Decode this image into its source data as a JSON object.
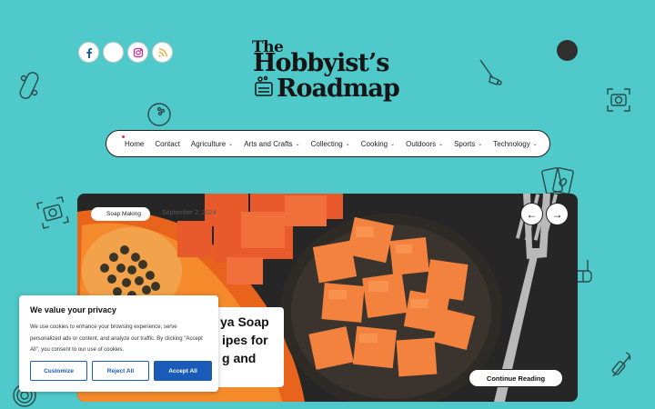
{
  "social": [
    {
      "name": "facebook",
      "icon": "facebook-icon"
    },
    {
      "name": "twitter",
      "icon": "twitter-icon"
    },
    {
      "name": "instagram",
      "icon": "instagram-icon"
    },
    {
      "name": "rss",
      "icon": "rss-icon"
    }
  ],
  "logo": {
    "line1": "The",
    "line2": "Hobbyist’s",
    "line3": "Roadmap"
  },
  "nav": {
    "home": "Home",
    "contact": "Contact",
    "agriculture": "Agriculture",
    "arts": "Arts and Crafts",
    "collecting": "Collecting",
    "cooking": "Cooking",
    "outdoors": "Outdoors",
    "sports": "Sports",
    "technology": "Technology"
  },
  "hero": {
    "category": "Soap Making",
    "date": "September 2, 2024",
    "title_line1": "ya Soap",
    "title_line2": "ipes for",
    "title_line3": "g and",
    "prev": "←",
    "next": "→",
    "cta": "Continue Reading"
  },
  "cookie": {
    "title": "We value your privacy",
    "body": "We use cookies to enhance your browsing experience, serve personalized ads or content, and analyze our traffic. By clicking \"Accept All\", you consent to our use of cookies.",
    "customize": "Customize",
    "reject": "Reject All",
    "accept": "Accept All"
  },
  "colors": {
    "background": "#4fc9c9",
    "accent": "#1a5bb8",
    "dark": "#1d1d1d"
  }
}
